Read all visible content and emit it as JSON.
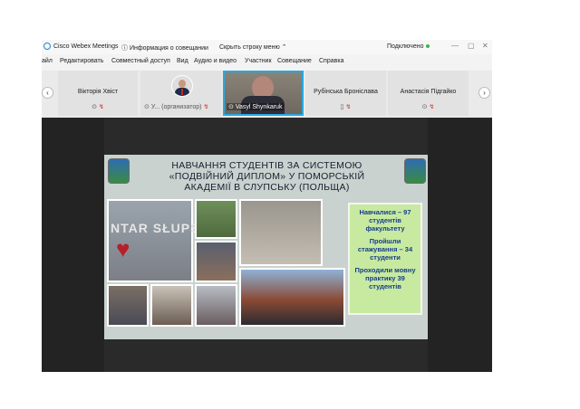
{
  "window": {
    "app_title": "Cisco Webex Meetings",
    "meeting_info": "Информация о совещании",
    "hide_menu": "Скрыть строку меню",
    "connection_status": "Подключено"
  },
  "menu": [
    "айл",
    "Редактировать",
    "Совместный доступ",
    "Вид",
    "Аудио и видео",
    "Участник",
    "Совещание",
    "Справка"
  ],
  "participants": [
    {
      "name": "Вікторія Хвіст",
      "icons": "⊙ ↯"
    },
    {
      "name": "У... (организатор)",
      "icons": "↯"
    },
    {
      "name": "Vasyl Shynkaruk",
      "icons": ""
    },
    {
      "name": "Рубінська Броніслава",
      "icons": "▯ ↯"
    },
    {
      "name": "Анастасія Підгайко",
      "icons": "⊙ ↯"
    }
  ],
  "slide": {
    "title_line1": "НАВЧАННЯ СТУДЕНТІВ ЗА СИСТЕМОЮ",
    "title_line2": "«ПОДВІЙНИЙ ДИПЛОМ» У ПОМОРСЬКІЙ",
    "title_line3": "АКАДЕМІЇ В СЛУПСЬКУ (ПОЛЬЩА)",
    "photo_sign": "NTAR SŁUPS",
    "stat1": "Навчалися – 97 студентів факультету",
    "stat2": "Пройшли стажування – 34 студенти",
    "stat3": "Проходили мовну практику 39 студентів"
  },
  "colors": {
    "accent": "#1a8ad4",
    "active_border": "#27a9e1",
    "info_box": "#c7eaa0",
    "info_text": "#163d8a"
  }
}
